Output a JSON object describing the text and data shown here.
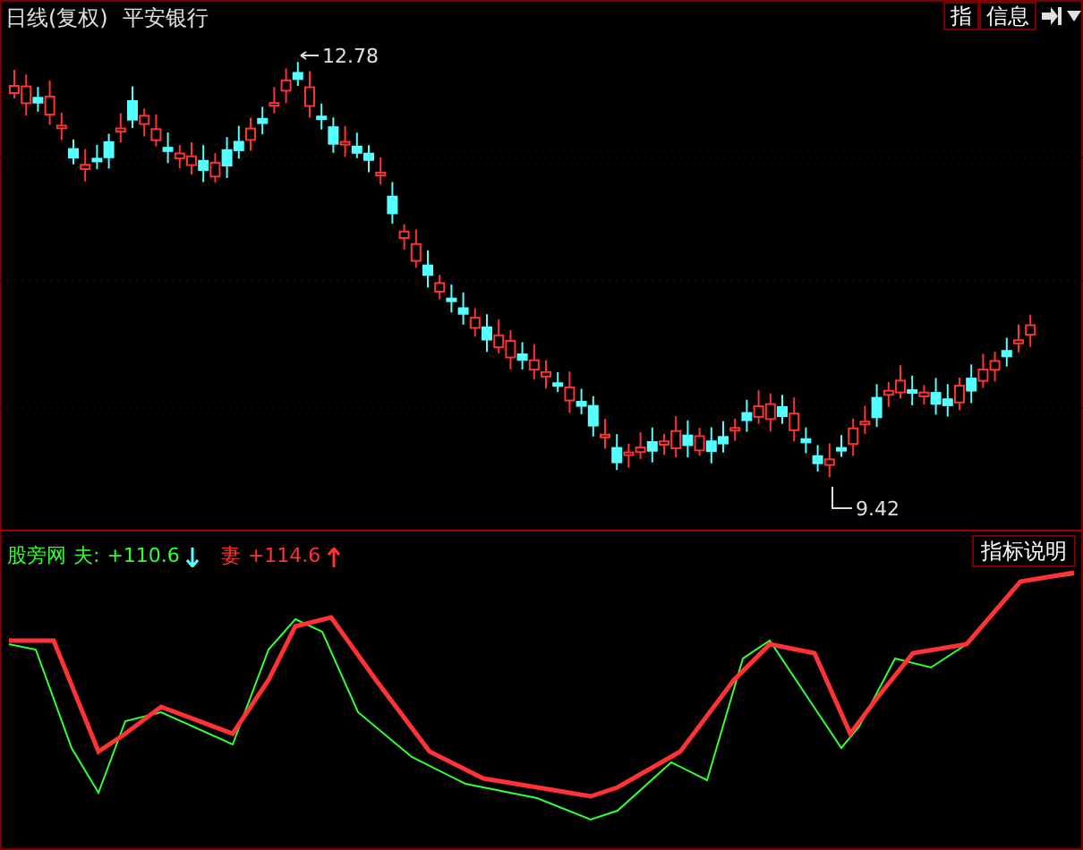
{
  "header": {
    "period": "日线(复权)",
    "security": "平安银行"
  },
  "toolbar": [
    {
      "label": "指"
    },
    {
      "label": "信息"
    }
  ],
  "price_chart": {
    "high_label": "12.78",
    "low_label": "9.42"
  },
  "indicator": {
    "name": "股旁网",
    "help_button": "指标说明",
    "lines": [
      {
        "label": "夫:",
        "value": "+110.6",
        "rising": false,
        "color": "#33ff33"
      },
      {
        "label": "妻",
        "value": "+114.6",
        "rising": true,
        "color": "#ff3333"
      }
    ]
  }
}
